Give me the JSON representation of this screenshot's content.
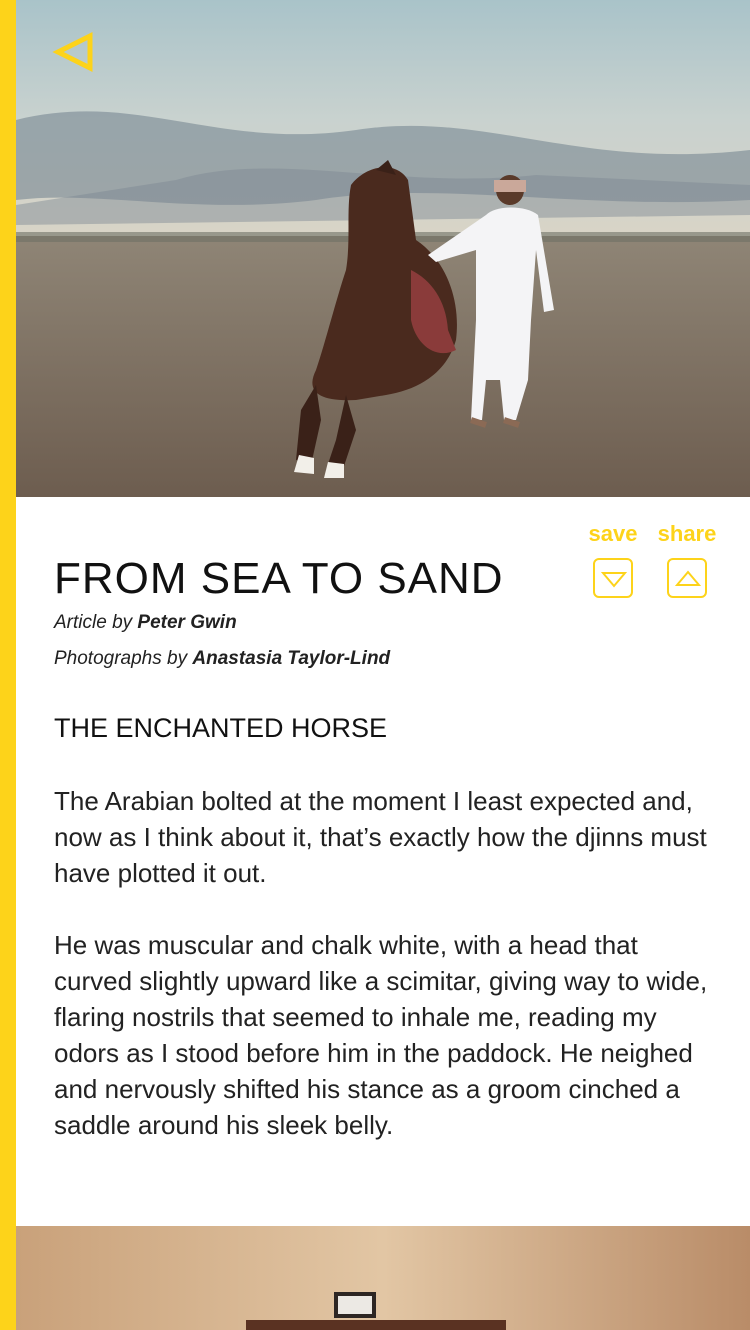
{
  "colors": {
    "accent": "#fdd31a",
    "text": "#222222",
    "background": "#ffffff"
  },
  "nav": {
    "back_icon": "back-triangle-icon"
  },
  "actions": {
    "save_label": "save",
    "save_icon": "down-triangle-icon",
    "share_label": "share",
    "share_icon": "up-triangle-icon"
  },
  "article": {
    "title": "FROM SEA TO SAND",
    "author_prefix": "Article by",
    "author": "Peter Gwin",
    "photographer_prefix": "Photographs by",
    "photographer": "Anastasia Taylor-Lind",
    "section_heading": "THE ENCHANTED HORSE",
    "paragraphs": [
      "The Arabian bolted at the moment I least expected and, now as I think about it, that’s exactly how the djinns must have plotted it out.",
      "He was muscular and chalk white, with a head that curved slightly upward like a scimitar, giving way to wide, flaring nostrils that seemed to inhale me, reading my odors as I stood before him in the paddock. He neighed and nervously shifted his stance as a groom cinched a saddle around his sleek belly."
    ]
  }
}
